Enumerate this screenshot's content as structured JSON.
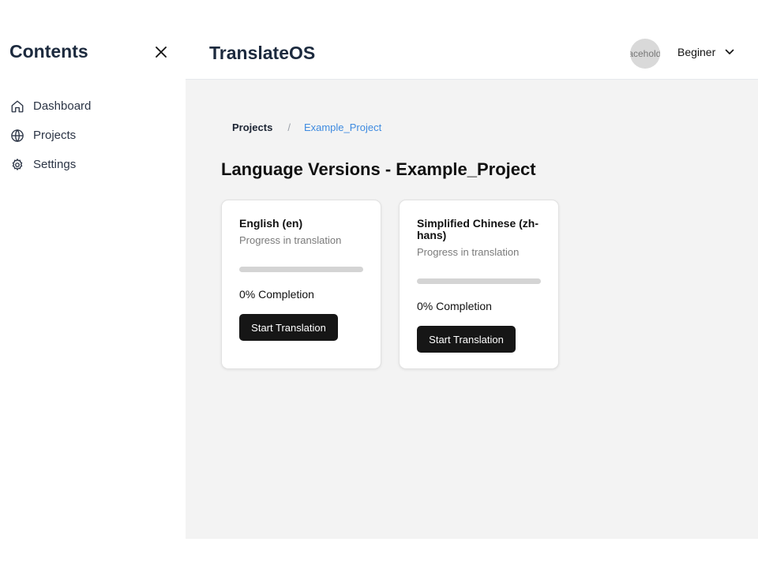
{
  "sidebar": {
    "title": "Contents",
    "items": [
      {
        "label": "Dashboard",
        "icon": "home-icon"
      },
      {
        "label": "Projects",
        "icon": "globe-icon"
      },
      {
        "label": "Settings",
        "icon": "gear-icon"
      }
    ]
  },
  "header": {
    "app_title": "TranslateOS",
    "avatar_text": "placeholder",
    "level": "Beginer"
  },
  "breadcrumb": {
    "root": "Projects",
    "separator": "/",
    "current": "Example_Project"
  },
  "page_title": "Language Versions - Example_Project",
  "cards": [
    {
      "title": "English (en)",
      "subtitle": "Progress in translation",
      "progress": 0,
      "completion": "0% Completion",
      "button": "Start Translation"
    },
    {
      "title": "Simplified Chinese (zh-hans)",
      "subtitle": "Progress in translation",
      "progress": 0,
      "completion": "0% Completion",
      "button": "Start Translation"
    }
  ],
  "colors": {
    "accent_link": "#3f8be0",
    "button_bg": "#161616",
    "main_bg": "#f3f3f3"
  }
}
